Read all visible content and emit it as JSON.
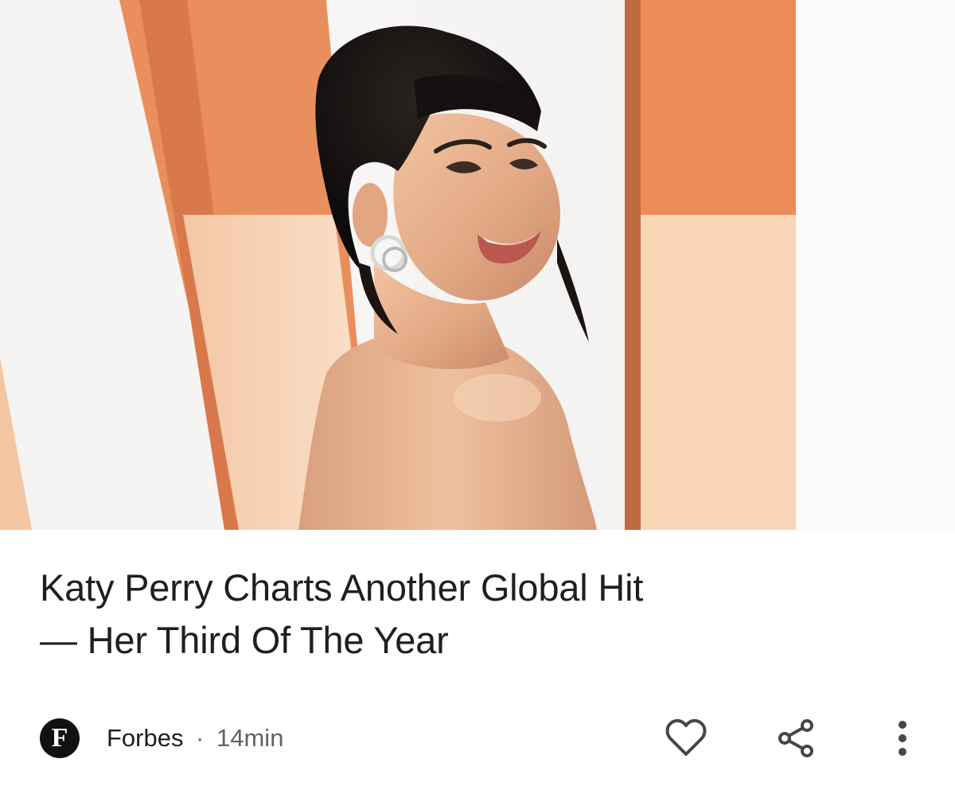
{
  "article": {
    "headline_line1": "Katy Perry Charts Another Global Hit",
    "headline_line2": "— Her Third Of The Year",
    "image_alt": "Katy Perry smiling over her shoulder against an orange and white striped backdrop"
  },
  "source": {
    "logo_letter": "F",
    "name": "Forbes",
    "separator": "·",
    "time": "14min"
  },
  "actions": {
    "like_icon": "heart-icon",
    "share_icon": "share-icon",
    "more_icon": "more-vertical-icon"
  },
  "colors": {
    "text_primary": "#1f1f1f",
    "text_secondary": "#5f6368",
    "icon": "#444746",
    "backdrop_orange": "#e68a5c",
    "backdrop_peach": "#f6c9a0"
  }
}
